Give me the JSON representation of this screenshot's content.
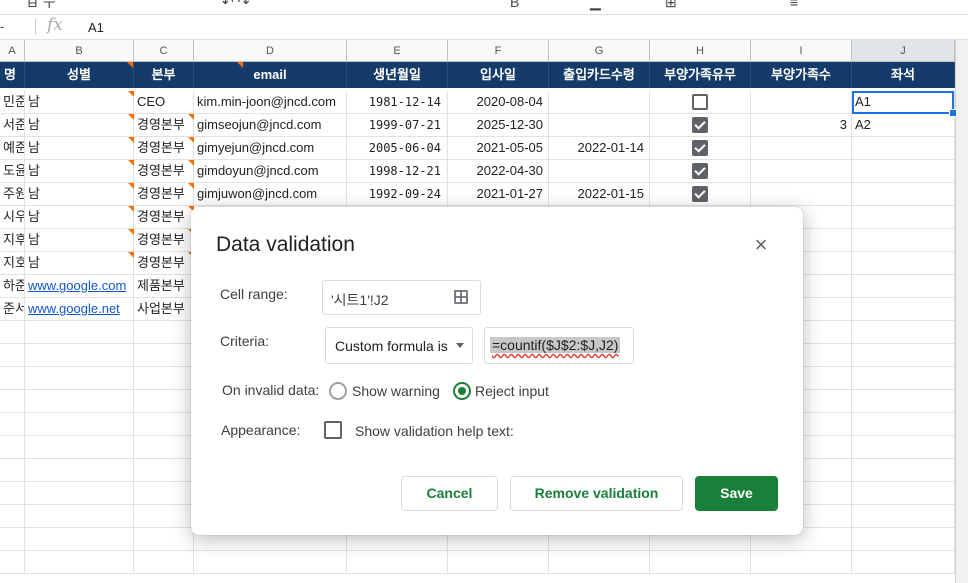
{
  "formula_bar": {
    "name_box": "-",
    "fx": "fx",
    "value": "A1"
  },
  "columns": [
    "A",
    "B",
    "C",
    "D",
    "E",
    "F",
    "G",
    "H",
    "I",
    "J"
  ],
  "header_row": [
    "명",
    "성별",
    "본부",
    "email",
    "생년월일",
    "입사일",
    "출입카드수령",
    "부양가족유무",
    "부양가족수",
    "좌석"
  ],
  "rows": [
    {
      "name": "민준",
      "gender": "남",
      "dept": "CEO",
      "email": "kim.min-joon@jncd.com",
      "birth": "1981-12-14",
      "join": "2020-08-04",
      "card": "",
      "has_dependents": false,
      "dependents": "",
      "seat": "A1"
    },
    {
      "name": "서준",
      "gender": "남",
      "dept": "경영본부",
      "email": "gimseojun@jncd.com",
      "birth": "1999-07-21",
      "join": "2025-12-30",
      "card": "",
      "has_dependents": true,
      "dependents": "3",
      "seat": "A2"
    },
    {
      "name": "예준",
      "gender": "남",
      "dept": "경영본부",
      "email": "gimyejun@jncd.com",
      "birth": "2005-06-04",
      "join": "2021-05-05",
      "card": "2022-01-14",
      "has_dependents": true,
      "dependents": "",
      "seat": ""
    },
    {
      "name": "도윤",
      "gender": "남",
      "dept": "경영본부",
      "email": "gimdoyun@jncd.com",
      "birth": "1998-12-21",
      "join": "2022-04-30",
      "card": "",
      "has_dependents": true,
      "dependents": "",
      "seat": ""
    },
    {
      "name": "주원",
      "gender": "남",
      "dept": "경영본부",
      "email": "gimjuwon@jncd.com",
      "birth": "1992-09-24",
      "join": "2021-01-27",
      "card": "2022-01-15",
      "has_dependents": true,
      "dependents": "",
      "seat": ""
    },
    {
      "name": "시우",
      "gender": "남",
      "dept": "경영본부",
      "email": "",
      "birth": "",
      "join": "",
      "card": "",
      "has_dependents": null,
      "dependents": "",
      "seat": ""
    },
    {
      "name": "지후",
      "gender": "남",
      "dept": "경영본부",
      "email": "",
      "birth": "",
      "join": "",
      "card": "",
      "has_dependents": null,
      "dependents": "",
      "seat": ""
    },
    {
      "name": "지호",
      "gender": "남",
      "dept": "경영본부",
      "email": "",
      "birth": "",
      "join": "",
      "card": "",
      "has_dependents": null,
      "dependents": "",
      "seat": ""
    },
    {
      "name": "하준",
      "gender": "www.google.com",
      "dept": "제품본부",
      "email": "",
      "birth": "",
      "join": "",
      "card": "",
      "has_dependents": null,
      "dependents": "",
      "seat": ""
    },
    {
      "name": "준서",
      "gender": "www.google.net",
      "dept": "사업본부",
      "email": "",
      "birth": "",
      "join": "",
      "card": "",
      "has_dependents": null,
      "dependents": "",
      "seat": ""
    }
  ],
  "dialog": {
    "title": "Data validation",
    "close_icon": "×",
    "cell_range_label": "Cell range:",
    "cell_range_value": "'시트1'!J2",
    "criteria_label": "Criteria:",
    "criteria_type": "Custom formula is",
    "criteria_formula": "=countif($J$2:$J,J2)",
    "invalid_label": "On invalid data:",
    "option_warning": "Show warning",
    "option_reject": "Reject input",
    "selected_option": "reject",
    "appearance_label": "Appearance:",
    "help_text_label": "Show validation help text:",
    "help_text_checked": false,
    "cancel": "Cancel",
    "remove": "Remove validation",
    "save": "Save"
  },
  "colors": {
    "header_bg": "#153b6b",
    "accent": "#188038",
    "selection": "#1a73e8",
    "comment_marker": "#ff6d00"
  }
}
